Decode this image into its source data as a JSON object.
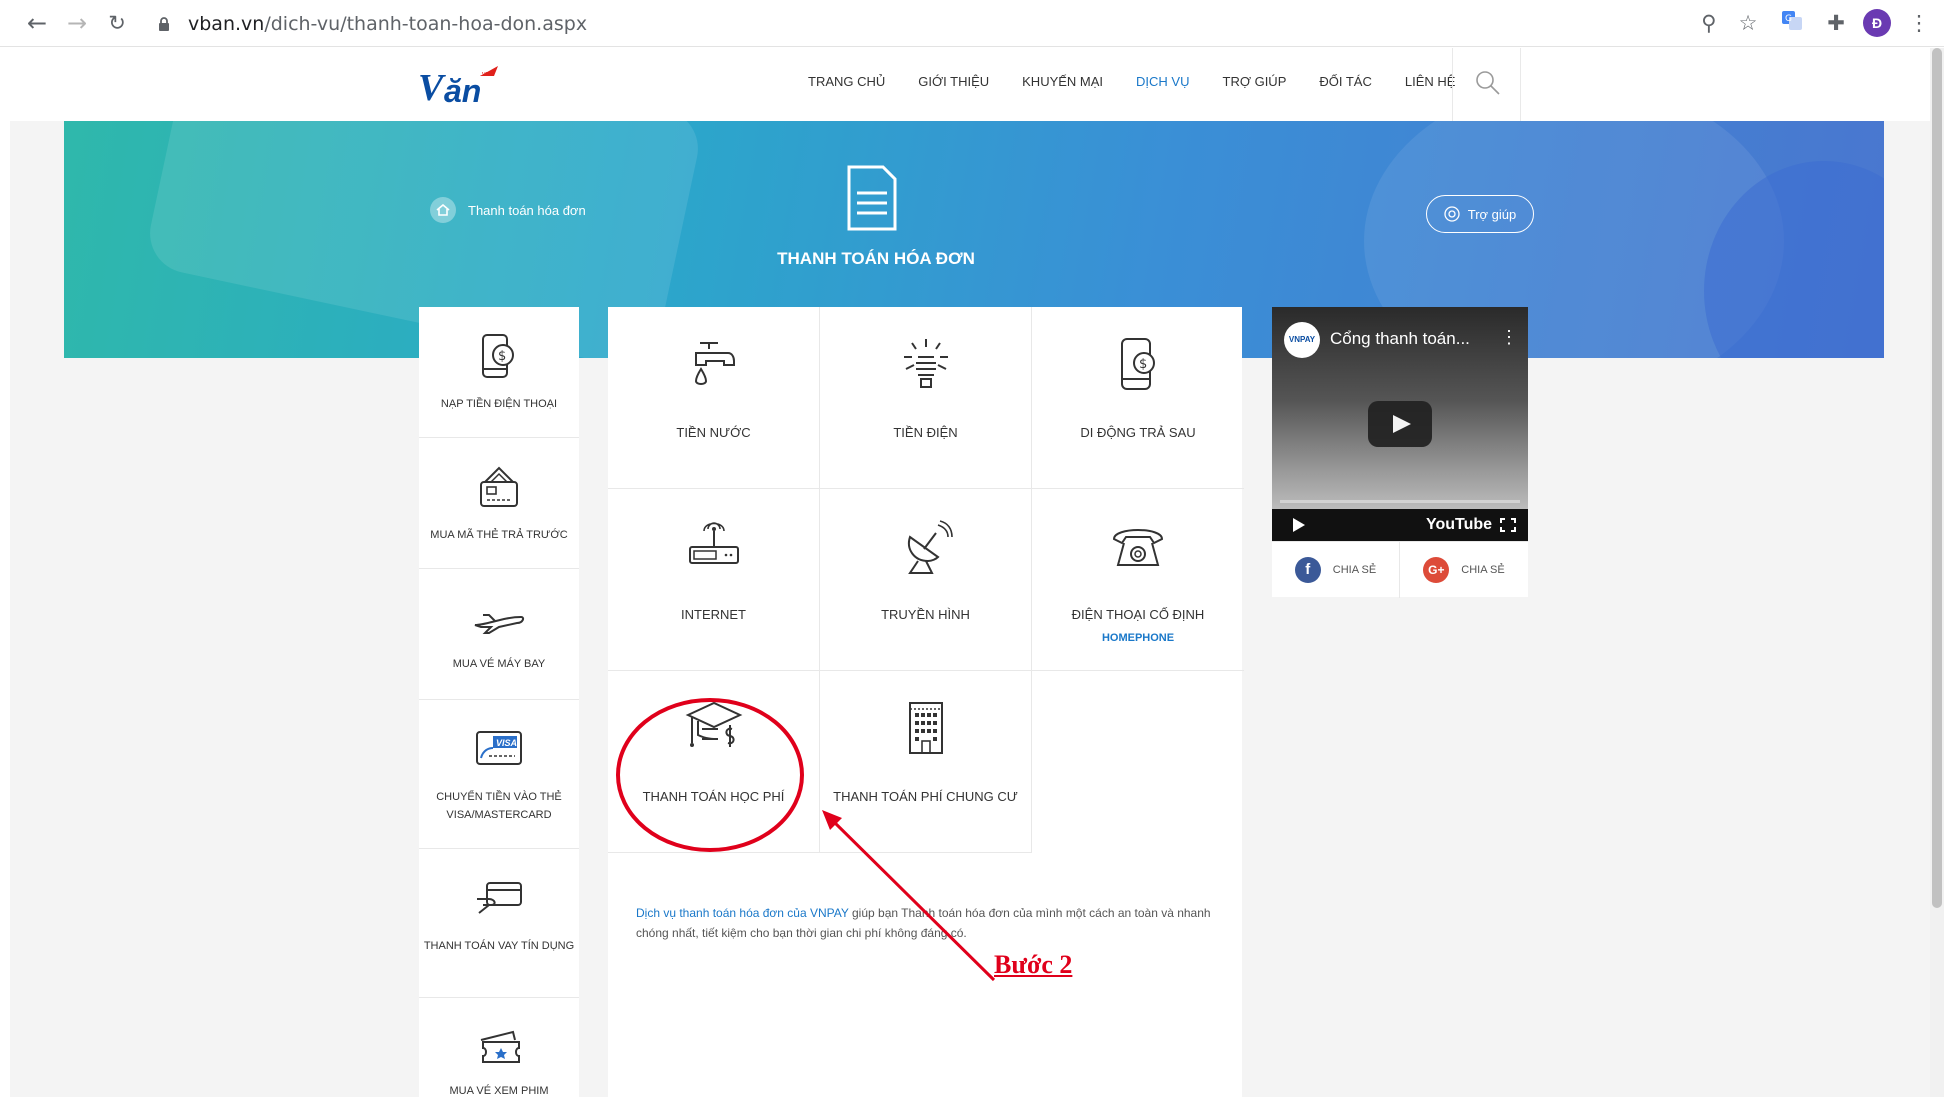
{
  "browser": {
    "url_host": "vban.vn",
    "url_path": "/dich-vu/thanh-toan-hoa-don.aspx",
    "avatar_letter": "Đ"
  },
  "header": {
    "menu": [
      "TRANG CHỦ",
      "GIỚI THIỆU",
      "KHUYẾN MẠI",
      "DỊCH VỤ",
      "TRỢ GIÚP",
      "ĐỐI TÁC",
      "LIÊN HỆ"
    ],
    "active_menu": "DỊCH VỤ"
  },
  "hero": {
    "breadcrumb": "Thanh toán hóa đơn",
    "title": "THANH TOÁN HÓA ĐƠN",
    "help_label": "Trợ giúp"
  },
  "sidebar": {
    "items": [
      {
        "label": "NẠP TIỀN ĐIỆN THOẠI",
        "icon": "phone-money-icon"
      },
      {
        "label": "MUA MÃ THẺ TRẢ TRƯỚC",
        "icon": "prepaid-card-icon"
      },
      {
        "label": "MUA VÉ MÁY BAY",
        "icon": "airplane-icon"
      },
      {
        "label": "CHUYỂN TIỀN VÀO THẺ VISA/MASTERCARD",
        "icon": "visa-card-icon",
        "visa": "VISA"
      },
      {
        "label": "THANH TOÁN VAY TÍN DỤNG",
        "icon": "credit-loan-icon"
      },
      {
        "label": "MUA VÉ XEM PHIM",
        "icon": "movie-ticket-icon"
      }
    ]
  },
  "services": {
    "cells": [
      {
        "label": "TIỀN NƯỚC",
        "icon": "water-tap-icon"
      },
      {
        "label": "TIỀN ĐIỆN",
        "icon": "light-bulb-icon"
      },
      {
        "label": "DI ĐỘNG TRẢ SAU",
        "icon": "postpaid-phone-icon"
      },
      {
        "label": "INTERNET",
        "icon": "router-icon"
      },
      {
        "label": "TRUYỀN HÌNH",
        "icon": "satellite-dish-icon"
      },
      {
        "label": "ĐIỆN THOẠI CỐ ĐỊNH",
        "sub": "HOMEPHONE",
        "icon": "landline-phone-icon"
      },
      {
        "label": "THANH TOÁN HỌC PHÍ",
        "icon": "graduation-cap-icon"
      },
      {
        "label": "THANH TOÁN PHÍ CHUNG CƯ",
        "icon": "apartment-building-icon"
      }
    ],
    "description_link": "Dịch vụ thanh toán hóa đơn của VNPAY",
    "description_rest": " giúp bạn Thanh toán hóa đơn của mình một cách an toàn và nhanh chóng nhất, tiết kiệm cho bạn thời gian chi phí không đáng có."
  },
  "video": {
    "title": "Cổng thanh toán...",
    "channel_logo": "VNPAY",
    "platform": "YouTube"
  },
  "share": {
    "facebook_label": "CHIA SẺ",
    "google_label": "CHIA SẺ",
    "facebook_glyph": "f",
    "google_glyph": "G+"
  },
  "annotation": {
    "step_label": "Bước 2",
    "color": "#e0001b"
  },
  "colors": {
    "accent": "#1a78c9",
    "hero_start": "#2fb8ab",
    "hero_end": "#4a76cf"
  }
}
